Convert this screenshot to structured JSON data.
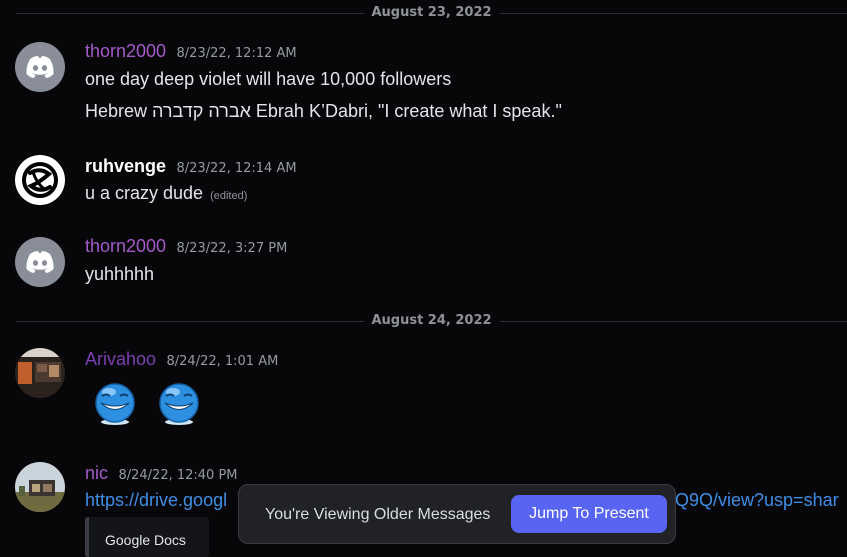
{
  "dividers": [
    "August 23, 2022",
    "August 24, 2022"
  ],
  "messages": [
    {
      "author": "thorn2000",
      "author_color": "#a45bc9",
      "timestamp": "8/23/22, 12:12 AM",
      "lines": [
        "one day deep violet will have 10,000 followers",
        "Hebrew אברה קדברה Ebrah K’Dabri, \"I create what I speak.\""
      ]
    },
    {
      "author": "ruhvenge",
      "author_color": "#ffffff",
      "timestamp": "8/23/22, 12:14 AM",
      "text": "u a crazy dude",
      "edited": "(edited)"
    },
    {
      "author": "thorn2000",
      "author_color": "#a45bc9",
      "timestamp": "8/23/22, 3:27 PM",
      "text": "yuhhhhh"
    },
    {
      "author": "Arivahoo",
      "author_color": "#7c3fb0",
      "timestamp": "8/24/22, 1:01 AM",
      "emojis": [
        "grinning-blue-emoji",
        "grinning-blue-emoji"
      ]
    },
    {
      "author": "nic",
      "author_color": "#a45bc9",
      "timestamp": "8/24/22, 12:40 PM",
      "link_start": "https://drive.googl",
      "link_end": "Q9Q/view?usp=shar",
      "embed_title": "Google Docs"
    }
  ],
  "toast": {
    "text": "You're Viewing Older Messages",
    "button": "Jump To Present"
  },
  "colors": {
    "background": "#070709",
    "accent": "#5865f2",
    "link": "#3f8ee6"
  }
}
